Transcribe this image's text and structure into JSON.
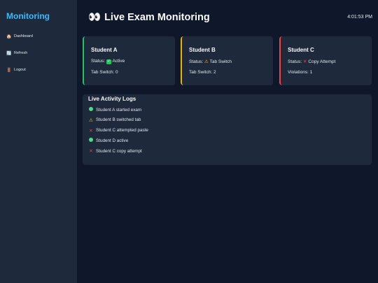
{
  "sidebar": {
    "brand": "Monitoring",
    "items": [
      {
        "icon": "home-icon",
        "glyph": "🏠",
        "label": "Dashboard"
      },
      {
        "icon": "refresh-icon",
        "glyph": "🔄",
        "label": "Refresh"
      },
      {
        "icon": "logout-door-icon",
        "glyph": "🚪",
        "label": "Logout"
      }
    ]
  },
  "header": {
    "title": "Live Exam Monitoring",
    "title_icon": "eyes-icon",
    "clock": "4:01:53 PM"
  },
  "cards": [
    {
      "name": "Student A",
      "status_label": "Status:",
      "status_icon": "check-mark-icon",
      "status": "Active",
      "metric": "Tab Switch: 0",
      "accent": "#22c55e"
    },
    {
      "name": "Student B",
      "status_label": "Status:",
      "status_icon": "warning-icon",
      "status": "Tab Switch",
      "metric": "Tab Switch: 2",
      "accent": "#eab308"
    },
    {
      "name": "Student C",
      "status_label": "Status:",
      "status_icon": "cross-mark-icon",
      "status": "Copy Attempt",
      "metric": "Violations: 1",
      "accent": "#ef4444"
    }
  ],
  "logs": {
    "title": "Live Activity Logs",
    "items": [
      {
        "icon": "green-circle-icon",
        "text": "Student A started exam"
      },
      {
        "icon": "warning-icon",
        "text": "Student B switched tab"
      },
      {
        "icon": "cross-mark-icon",
        "text": "Student C attempted paste"
      },
      {
        "icon": "green-circle-icon",
        "text": "Student D active"
      },
      {
        "icon": "cross-mark-icon",
        "text": "Student C copy attempt"
      }
    ]
  },
  "colors": {
    "background": "#0f172a",
    "panel": "#1e293b",
    "brand": "#38bdf8",
    "ok": "#22c55e",
    "warn": "#eab308",
    "danger": "#ef4444"
  }
}
